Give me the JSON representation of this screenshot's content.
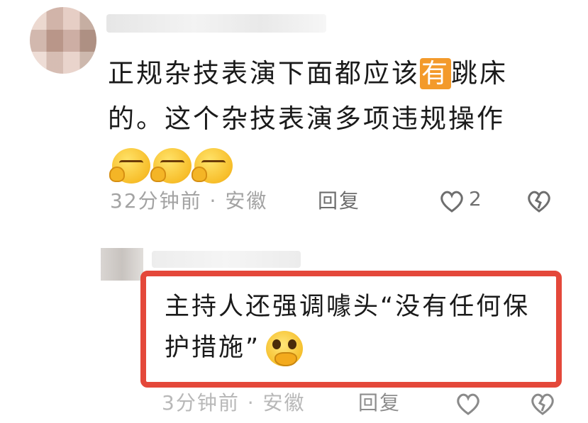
{
  "comment1": {
    "text_before": "正规杂技表演下面都应该",
    "highlight": "有",
    "text_after": "跳床的。这个杂技表演多项违规操作",
    "emoji_count": 3,
    "time": "32分钟前",
    "separator": "·",
    "location": "安徽",
    "reply_label": "回复",
    "like_count": "2",
    "icons": {
      "like": "heart-outline-icon",
      "dislike": "broken-heart-icon"
    }
  },
  "comment2": {
    "text": "主持人还强调噱头“没有任何保护措施”",
    "time": "3分钟前",
    "separator": "·",
    "location": "安徽",
    "reply_label": "回复"
  },
  "colors": {
    "highlight": "#f39a2b",
    "box_border": "#e4483a",
    "meta_gray": "#a3a3a3"
  }
}
